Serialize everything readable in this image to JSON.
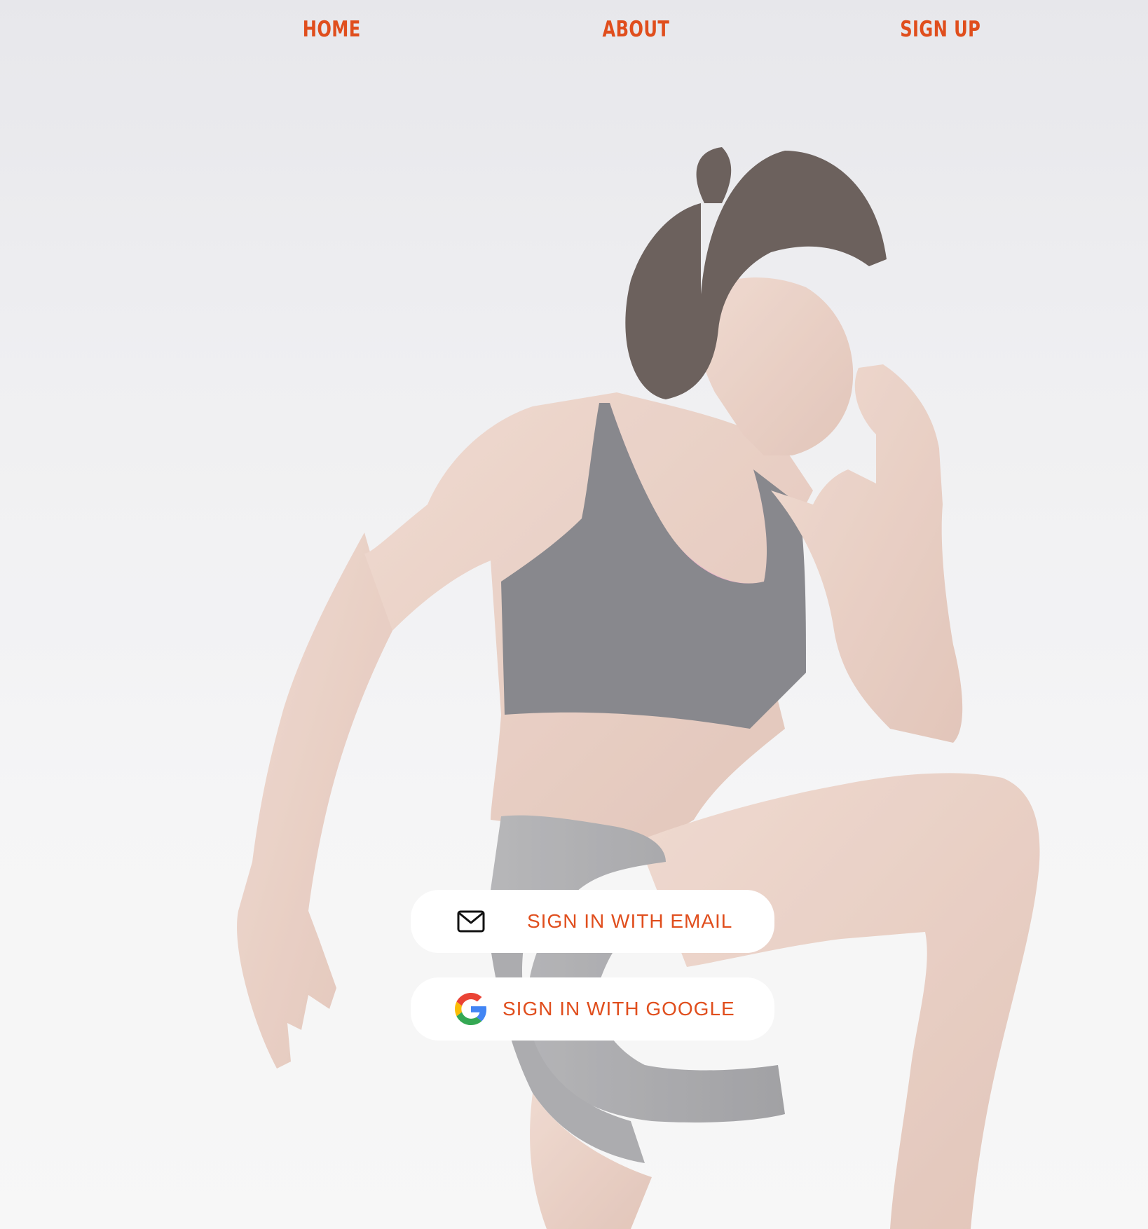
{
  "theme": {
    "accent": "#e04e1d",
    "button_bg": "#ffffff"
  },
  "nav": {
    "items": [
      {
        "label": "HOME"
      },
      {
        "label": "ABOUT"
      },
      {
        "label": "SIGN UP"
      }
    ]
  },
  "hero": {
    "image": "athlete-woman-high-knee"
  },
  "auth": {
    "email": {
      "label": "SIGN IN WITH EMAIL",
      "icon": "mail-icon"
    },
    "google": {
      "label": "SIGN IN WITH GOOGLE",
      "icon": "google-icon"
    }
  }
}
